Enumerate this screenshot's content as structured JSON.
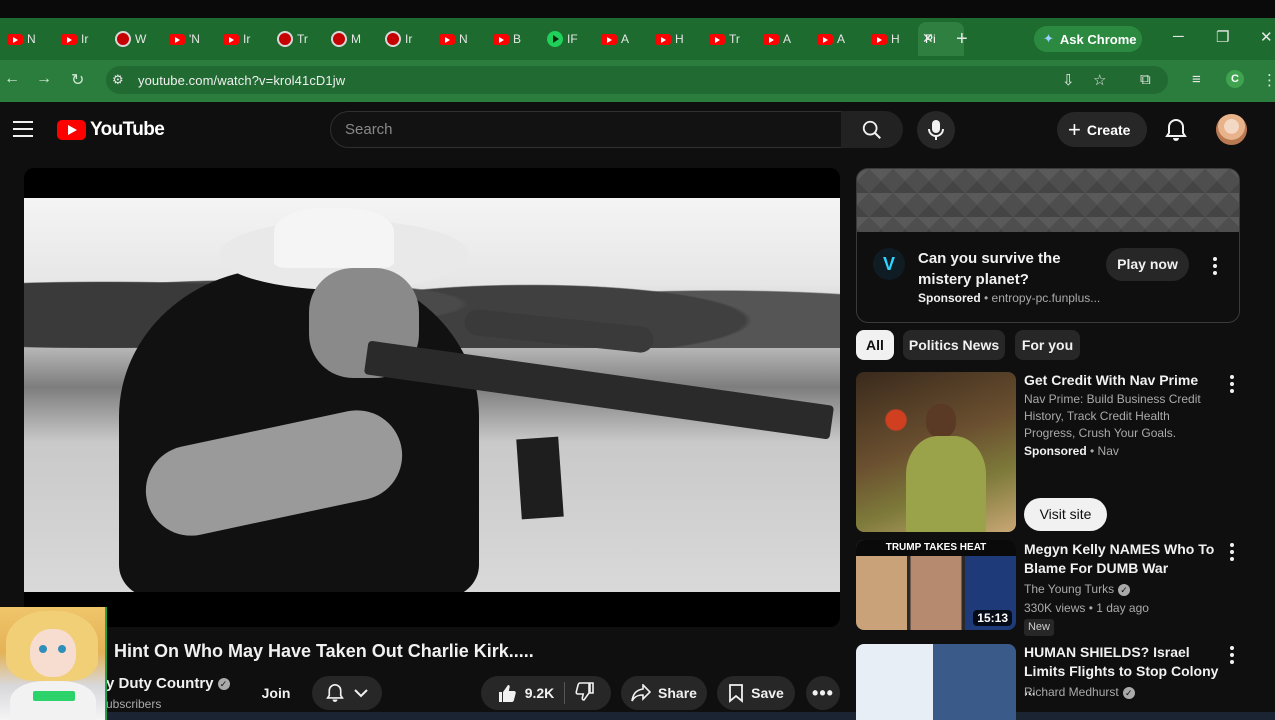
{
  "browser": {
    "tabs": [
      {
        "favicon": "youtube",
        "label": "N"
      },
      {
        "favicon": "youtube",
        "label": "Ir"
      },
      {
        "favicon": "ring",
        "label": "W"
      },
      {
        "favicon": "youtube",
        "label": "'N"
      },
      {
        "favicon": "youtube",
        "label": "Ir"
      },
      {
        "favicon": "ring",
        "label": "Tr"
      },
      {
        "favicon": "ring",
        "label": "M"
      },
      {
        "favicon": "ring",
        "label": "Ir"
      },
      {
        "favicon": "youtube",
        "label": "N"
      },
      {
        "favicon": "youtube",
        "label": "B"
      },
      {
        "favicon": "play-green",
        "label": "IF"
      },
      {
        "favicon": "youtube",
        "label": "A"
      },
      {
        "favicon": "youtube",
        "label": "H"
      },
      {
        "favicon": "youtube",
        "label": "Tr"
      },
      {
        "favicon": "youtube",
        "label": "A"
      },
      {
        "favicon": "youtube",
        "label": "A"
      },
      {
        "favicon": "youtube",
        "label": "H"
      }
    ],
    "active_tab_label": "Pi",
    "ask_chrome": "Ask Chrome",
    "url": "youtube.com/watch?v=krol41cD1jw",
    "profile_initial": "C",
    "colors": {
      "frame": "#1d6b2e",
      "toolbar": "#2b7d3d"
    }
  },
  "youtube": {
    "logo_text": "YouTube",
    "search_placeholder": "Search",
    "create_label": "Create"
  },
  "video": {
    "title": "Hint On Who May Have Taken Out Charlie Kirk.....",
    "channel": "y Duty Country",
    "subscribers": "ubscribers",
    "join_label": "Join",
    "likes": "9.2K",
    "share_label": "Share",
    "save_label": "Save"
  },
  "ad": {
    "logo_glyph": "V",
    "title": "Can you survive the mistery planet?",
    "sponsored_label": "Sponsored",
    "sponsor_domain": " • entropy-pc.funplus...",
    "cta_label": "Play now"
  },
  "chips": [
    {
      "label": "All",
      "active": true
    },
    {
      "label": "Politics News",
      "active": false
    },
    {
      "label": "For you",
      "active": false
    }
  ],
  "recommendations": {
    "nav": {
      "title": "Get Credit With Nav Prime",
      "description": "Nav Prime: Build Business Credit History, Track Credit Health Progress, Crush Your Goals.",
      "sponsored_label": "Sponsored",
      "advertiser": " • Nav",
      "cta_label": "Visit site"
    },
    "megyn": {
      "thumb_banner": "TRUMP TAKES HEAT",
      "duration": "15:13",
      "title": "Megyn Kelly NAMES Who To Blame For DUMB War",
      "channel": "The Young Turks",
      "stats": "330K views • 1 day ago",
      "badge": "New"
    },
    "shields": {
      "title": "HUMAN SHIELDS? Israel Limits Flights to Stop Colony ...",
      "channel": "Richard Medhurst"
    }
  }
}
